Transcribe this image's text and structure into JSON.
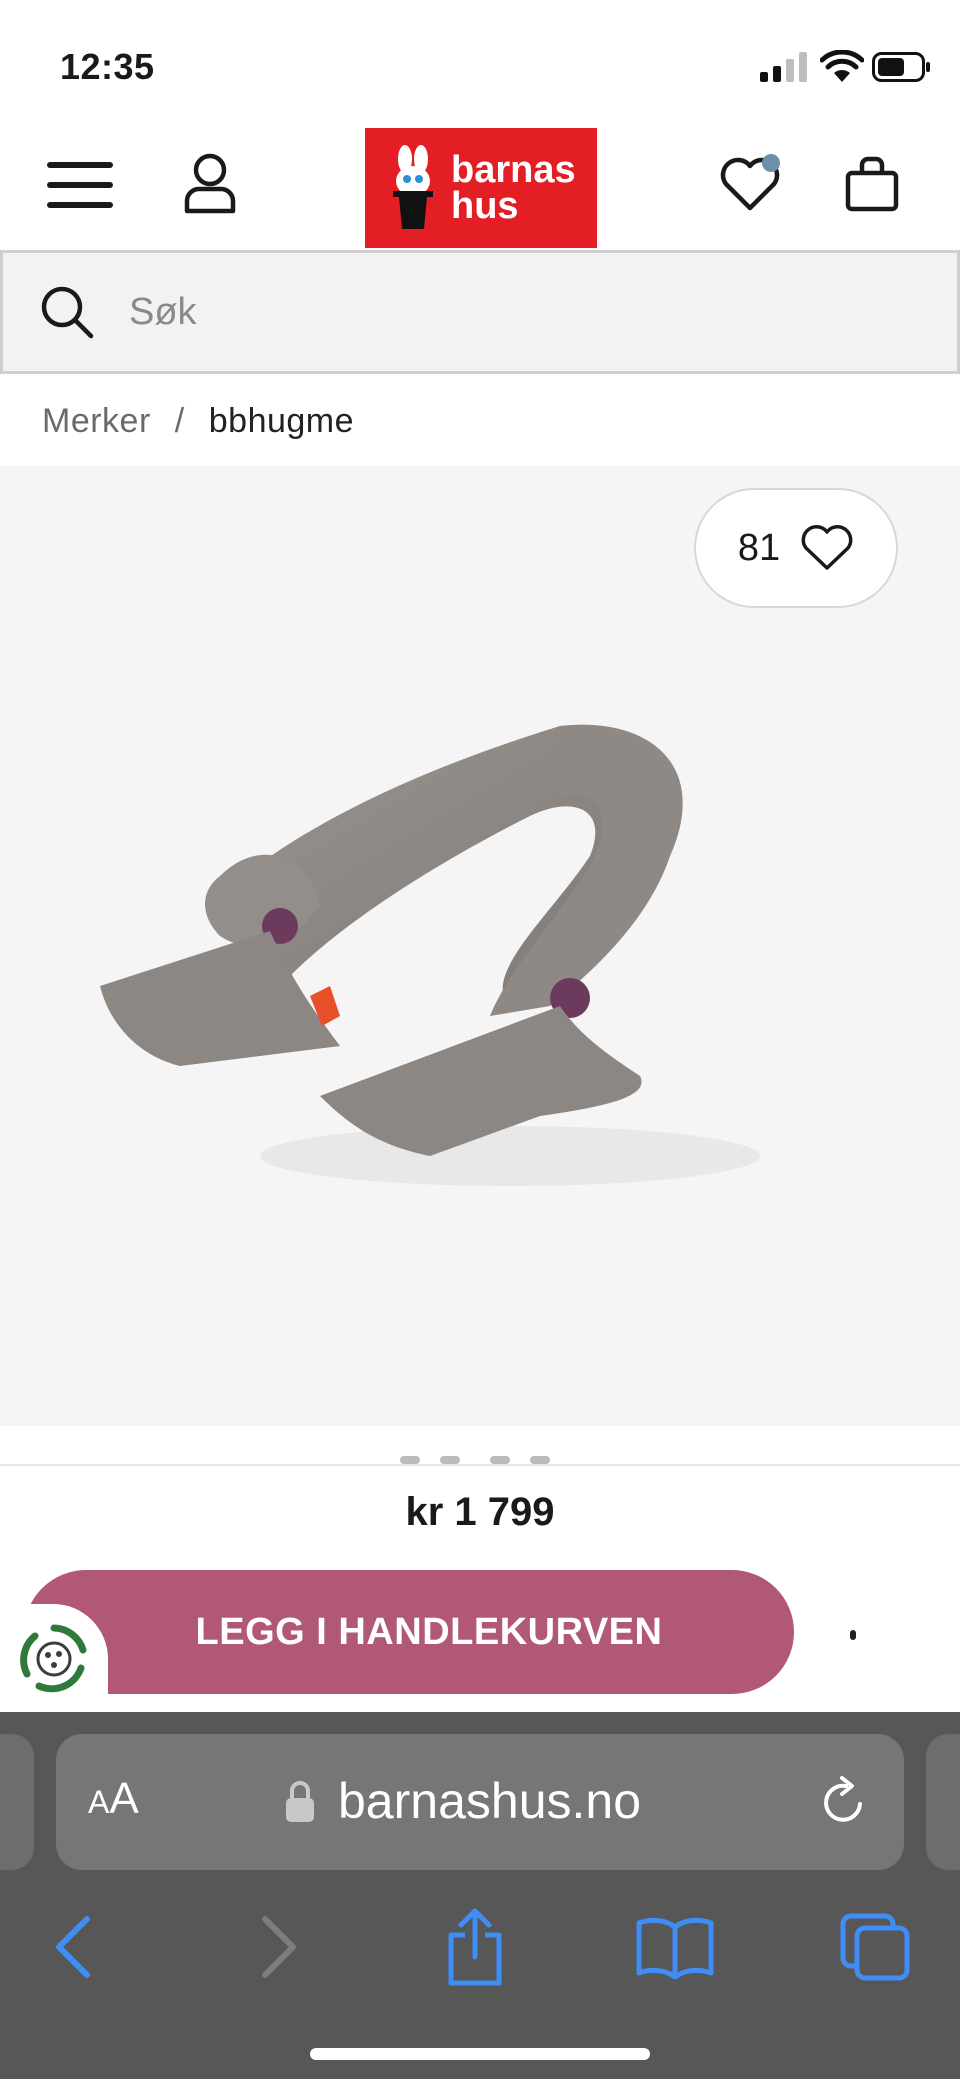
{
  "status_bar": {
    "time": "12:35"
  },
  "header": {
    "logo_line1": "barnas",
    "logo_line2": "hus",
    "brand_color": "#e31e24"
  },
  "search": {
    "placeholder": "Søk"
  },
  "breadcrumb": {
    "root": "Merker",
    "separator": "/",
    "current": "bbhugme"
  },
  "product": {
    "like_count": "81",
    "price": "kr 1 799",
    "add_to_cart_label": "LEGG I HANDLEKURVEN",
    "cta_color": "#b05876"
  },
  "browser": {
    "text_size_small": "A",
    "text_size_large": "A",
    "url": "barnashus.no"
  },
  "icons": {
    "menu": "hamburger-icon",
    "account": "user-icon",
    "wishlist": "heart-icon",
    "cart": "bag-icon",
    "search": "search-icon",
    "eco": "recycle-icon",
    "lock": "lock-icon",
    "reload": "reload-icon",
    "back": "chevron-left-icon",
    "forward": "chevron-right-icon",
    "share": "share-icon",
    "bookmarks": "book-icon",
    "tabs": "tabs-icon"
  }
}
